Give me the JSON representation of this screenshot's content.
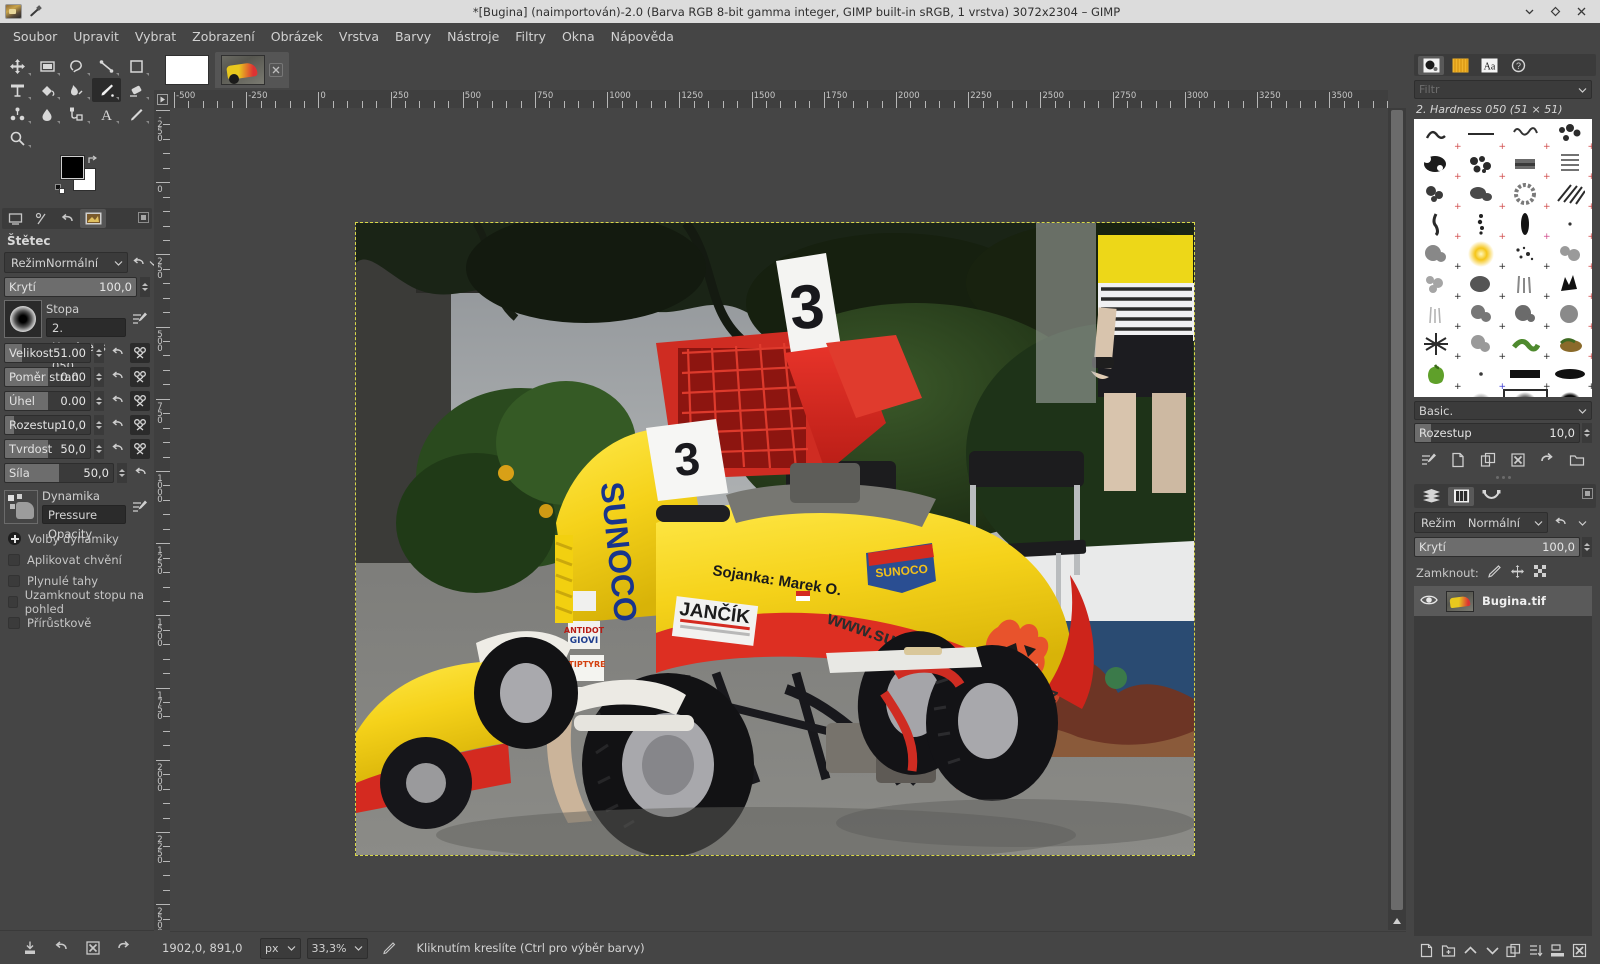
{
  "window": {
    "title": "*[Bugina] (naimportován)-2.0 (Barva RGB 8-bit gamma integer, GIMP built-in sRGB, 1 vrstva) 3072x2304 – GIMP",
    "controls": [
      "minimize-icon",
      "maximize-icon",
      "close-icon"
    ]
  },
  "menubar": {
    "items": [
      {
        "label": "Soubor"
      },
      {
        "label": "Upravit"
      },
      {
        "label": "Vybrat"
      },
      {
        "label": "Zobrazení"
      },
      {
        "label": "Obrázek"
      },
      {
        "label": "Vrstva"
      },
      {
        "label": "Barvy"
      },
      {
        "label": "Nástroje"
      },
      {
        "label": "Filtry"
      },
      {
        "label": "Okna"
      },
      {
        "label": "Nápověda"
      }
    ]
  },
  "toolbox": {
    "tools": [
      "move-tool",
      "rect-select-tool",
      "free-select-tool",
      "measure-tool",
      "crop-tool",
      "transform-tool",
      "bucket-fill-tool",
      "smudge-tool",
      "paintbrush-tool",
      "eraser-tool",
      "clone-tool",
      "blur-tool",
      "path-tool",
      "text-tool",
      "gradient-tool",
      "zoom-tool"
    ],
    "active": "paintbrush-tool",
    "foreground_color": "#000000",
    "background_color": "#ffffff"
  },
  "tool_options": {
    "title": "Štětec",
    "mode": {
      "label": "Režim",
      "value": "Normální"
    },
    "opacity": {
      "label": "Krytí",
      "value": "100,0",
      "percent": 100
    },
    "brush": {
      "label": "Stopa",
      "value": "2. Hardness 050"
    },
    "size": {
      "label": "Velikost",
      "value": "51.00",
      "percent": 20
    },
    "aspect": {
      "label": "Poměr stran",
      "value": "0.00",
      "percent": 50
    },
    "angle": {
      "label": "Úhel",
      "value": "0.00",
      "percent": 50
    },
    "spacing": {
      "label": "Rozestup",
      "value": "10,0",
      "percent": 10
    },
    "hardness": {
      "label": "Tvrdost",
      "value": "50,0",
      "percent": 50
    },
    "force": {
      "label": "Síla",
      "value": "50,0",
      "percent": 50
    },
    "dynamics": {
      "label": "Dynamika",
      "value": "Pressure Opacity"
    },
    "checks": [
      {
        "label": "Volby dynamiky",
        "checked": true,
        "expander": true
      },
      {
        "label": "Aplikovat chvění",
        "checked": false
      },
      {
        "label": "Plynulé tahy",
        "checked": false
      },
      {
        "label": "Uzamknout stopu na pohled",
        "checked": false
      },
      {
        "label": "Přírůstkově",
        "checked": false
      }
    ],
    "bottom_buttons": [
      "save-tool-preset-icon",
      "restore-tool-preset-icon",
      "delete-tool-preset-icon",
      "reset-tool-options-icon"
    ]
  },
  "image_window": {
    "tabs": [
      {
        "name": "untitled-white-image",
        "selected": false
      },
      {
        "name": "bugina-image",
        "selected": true,
        "closable": true
      }
    ],
    "rulers": {
      "horizontal_labels": [
        "-500",
        "-250",
        "0",
        "250",
        "500",
        "750",
        "1000",
        "1250",
        "1500",
        "1750",
        "2000",
        "2250",
        "2500",
        "2750",
        "3000",
        "3250",
        "3500"
      ],
      "vertical_labels": [
        "-250",
        "0",
        "250",
        "500",
        "750",
        "1000",
        "1250",
        "1500",
        "1750",
        "2000",
        "2250",
        "2500"
      ]
    }
  },
  "statusbar": {
    "pointer_position": "1902,0, 891,0",
    "unit": "px",
    "zoom": "33,3%",
    "message": "Kliknutím kreslíte (Ctrl pro výběr barvy)"
  },
  "right_dock": {
    "tabs": [
      "brushes-tab",
      "patterns-tab",
      "fonts-tab",
      "help-tab"
    ],
    "selected_tab": "brushes-tab",
    "filter_placeholder": "Filtr",
    "brush_header": "2. Hardness 050 (51 × 51)",
    "brush_set": {
      "label": "Basic.",
      "value": "Basic."
    },
    "spacing": {
      "label": "Rozestup",
      "value": "10,0"
    },
    "brush_buttons": [
      "edit-brush-icon",
      "new-brush-icon",
      "duplicate-brush-icon",
      "delete-brush-icon",
      "refresh-brushes-icon",
      "open-brush-folder-icon"
    ],
    "layers": {
      "tabs": [
        "layers-tab",
        "channels-tab",
        "paths-tab"
      ],
      "selected_tab": "channels-tab",
      "mode": {
        "label": "Režim",
        "value": "Normální"
      },
      "opacity": {
        "label": "Krytí",
        "value": "100,0"
      },
      "lock": {
        "label": "Zamknout:",
        "options": [
          "lock-pixels-icon",
          "lock-position-icon",
          "lock-alpha-icon"
        ]
      },
      "items": [
        {
          "name": "Bugina.tif",
          "visible": true
        }
      ],
      "bottom_buttons": [
        "new-layer-icon",
        "new-layer-group-icon",
        "raise-layer-icon",
        "lower-layer-icon",
        "duplicate-layer-icon",
        "anchor-layer-icon",
        "merge-down-icon",
        "delete-layer-icon"
      ]
    }
  },
  "colors": {
    "chrome": "#454545",
    "panel": "#3b3b3b",
    "titlebar": "#dcdcdc",
    "accent_selection": "#d8d849",
    "text": "#c3c3c3"
  }
}
